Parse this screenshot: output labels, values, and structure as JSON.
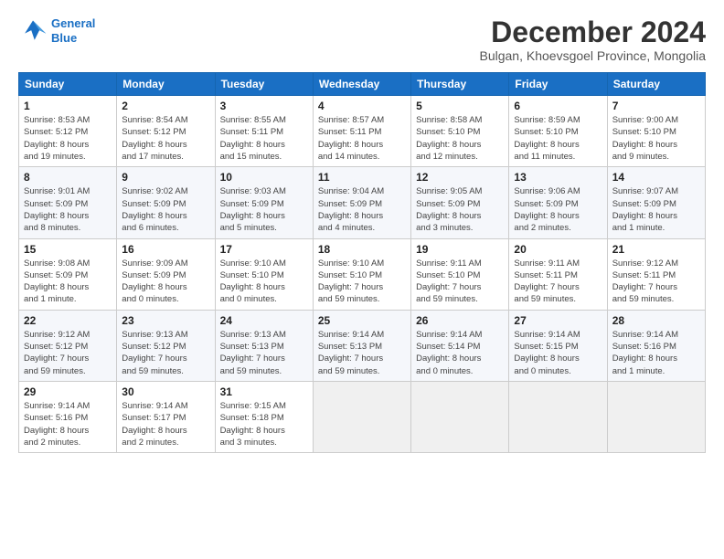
{
  "logo": {
    "line1": "General",
    "line2": "Blue"
  },
  "title": "December 2024",
  "subtitle": "Bulgan, Khoevsgoel Province, Mongolia",
  "header": {
    "days": [
      "Sunday",
      "Monday",
      "Tuesday",
      "Wednesday",
      "Thursday",
      "Friday",
      "Saturday"
    ]
  },
  "weeks": [
    {
      "cells": [
        {
          "day": "1",
          "info": "Sunrise: 8:53 AM\nSunset: 5:12 PM\nDaylight: 8 hours\nand 19 minutes."
        },
        {
          "day": "2",
          "info": "Sunrise: 8:54 AM\nSunset: 5:12 PM\nDaylight: 8 hours\nand 17 minutes."
        },
        {
          "day": "3",
          "info": "Sunrise: 8:55 AM\nSunset: 5:11 PM\nDaylight: 8 hours\nand 15 minutes."
        },
        {
          "day": "4",
          "info": "Sunrise: 8:57 AM\nSunset: 5:11 PM\nDaylight: 8 hours\nand 14 minutes."
        },
        {
          "day": "5",
          "info": "Sunrise: 8:58 AM\nSunset: 5:10 PM\nDaylight: 8 hours\nand 12 minutes."
        },
        {
          "day": "6",
          "info": "Sunrise: 8:59 AM\nSunset: 5:10 PM\nDaylight: 8 hours\nand 11 minutes."
        },
        {
          "day": "7",
          "info": "Sunrise: 9:00 AM\nSunset: 5:10 PM\nDaylight: 8 hours\nand 9 minutes."
        }
      ]
    },
    {
      "cells": [
        {
          "day": "8",
          "info": "Sunrise: 9:01 AM\nSunset: 5:09 PM\nDaylight: 8 hours\nand 8 minutes."
        },
        {
          "day": "9",
          "info": "Sunrise: 9:02 AM\nSunset: 5:09 PM\nDaylight: 8 hours\nand 6 minutes."
        },
        {
          "day": "10",
          "info": "Sunrise: 9:03 AM\nSunset: 5:09 PM\nDaylight: 8 hours\nand 5 minutes."
        },
        {
          "day": "11",
          "info": "Sunrise: 9:04 AM\nSunset: 5:09 PM\nDaylight: 8 hours\nand 4 minutes."
        },
        {
          "day": "12",
          "info": "Sunrise: 9:05 AM\nSunset: 5:09 PM\nDaylight: 8 hours\nand 3 minutes."
        },
        {
          "day": "13",
          "info": "Sunrise: 9:06 AM\nSunset: 5:09 PM\nDaylight: 8 hours\nand 2 minutes."
        },
        {
          "day": "14",
          "info": "Sunrise: 9:07 AM\nSunset: 5:09 PM\nDaylight: 8 hours\nand 1 minute."
        }
      ]
    },
    {
      "cells": [
        {
          "day": "15",
          "info": "Sunrise: 9:08 AM\nSunset: 5:09 PM\nDaylight: 8 hours\nand 1 minute."
        },
        {
          "day": "16",
          "info": "Sunrise: 9:09 AM\nSunset: 5:09 PM\nDaylight: 8 hours\nand 0 minutes."
        },
        {
          "day": "17",
          "info": "Sunrise: 9:10 AM\nSunset: 5:10 PM\nDaylight: 8 hours\nand 0 minutes."
        },
        {
          "day": "18",
          "info": "Sunrise: 9:10 AM\nSunset: 5:10 PM\nDaylight: 7 hours\nand 59 minutes."
        },
        {
          "day": "19",
          "info": "Sunrise: 9:11 AM\nSunset: 5:10 PM\nDaylight: 7 hours\nand 59 minutes."
        },
        {
          "day": "20",
          "info": "Sunrise: 9:11 AM\nSunset: 5:11 PM\nDaylight: 7 hours\nand 59 minutes."
        },
        {
          "day": "21",
          "info": "Sunrise: 9:12 AM\nSunset: 5:11 PM\nDaylight: 7 hours\nand 59 minutes."
        }
      ]
    },
    {
      "cells": [
        {
          "day": "22",
          "info": "Sunrise: 9:12 AM\nSunset: 5:12 PM\nDaylight: 7 hours\nand 59 minutes."
        },
        {
          "day": "23",
          "info": "Sunrise: 9:13 AM\nSunset: 5:12 PM\nDaylight: 7 hours\nand 59 minutes."
        },
        {
          "day": "24",
          "info": "Sunrise: 9:13 AM\nSunset: 5:13 PM\nDaylight: 7 hours\nand 59 minutes."
        },
        {
          "day": "25",
          "info": "Sunrise: 9:14 AM\nSunset: 5:13 PM\nDaylight: 7 hours\nand 59 minutes."
        },
        {
          "day": "26",
          "info": "Sunrise: 9:14 AM\nSunset: 5:14 PM\nDaylight: 8 hours\nand 0 minutes."
        },
        {
          "day": "27",
          "info": "Sunrise: 9:14 AM\nSunset: 5:15 PM\nDaylight: 8 hours\nand 0 minutes."
        },
        {
          "day": "28",
          "info": "Sunrise: 9:14 AM\nSunset: 5:16 PM\nDaylight: 8 hours\nand 1 minute."
        }
      ]
    },
    {
      "cells": [
        {
          "day": "29",
          "info": "Sunrise: 9:14 AM\nSunset: 5:16 PM\nDaylight: 8 hours\nand 2 minutes."
        },
        {
          "day": "30",
          "info": "Sunrise: 9:14 AM\nSunset: 5:17 PM\nDaylight: 8 hours\nand 2 minutes."
        },
        {
          "day": "31",
          "info": "Sunrise: 9:15 AM\nSunset: 5:18 PM\nDaylight: 8 hours\nand 3 minutes."
        },
        {
          "day": "",
          "info": ""
        },
        {
          "day": "",
          "info": ""
        },
        {
          "day": "",
          "info": ""
        },
        {
          "day": "",
          "info": ""
        }
      ]
    }
  ]
}
